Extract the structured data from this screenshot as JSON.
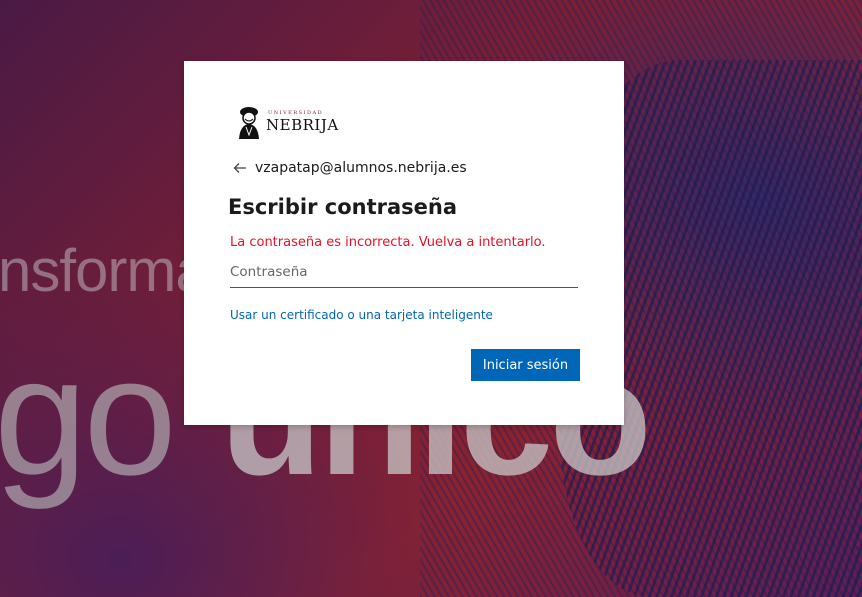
{
  "background": {
    "text_line1": "nsforma",
    "text_line2a": "go",
    "text_line2b": "único"
  },
  "logo": {
    "top_text": "UNIVERSIDAD",
    "name": "NEBRIJA"
  },
  "identity": {
    "email": "vzapatap@alumnos.nebrija.es"
  },
  "title": "Escribir contraseña",
  "error_message": "La contraseña es incorrecta. Vuelva a intentarlo.",
  "password_field": {
    "placeholder": "Contraseña",
    "value": ""
  },
  "certificate_link": "Usar un certificado o una tarjeta inteligente",
  "signin_button": "Iniciar sesión",
  "colors": {
    "accent": "#0067b8",
    "error": "#e81123"
  }
}
